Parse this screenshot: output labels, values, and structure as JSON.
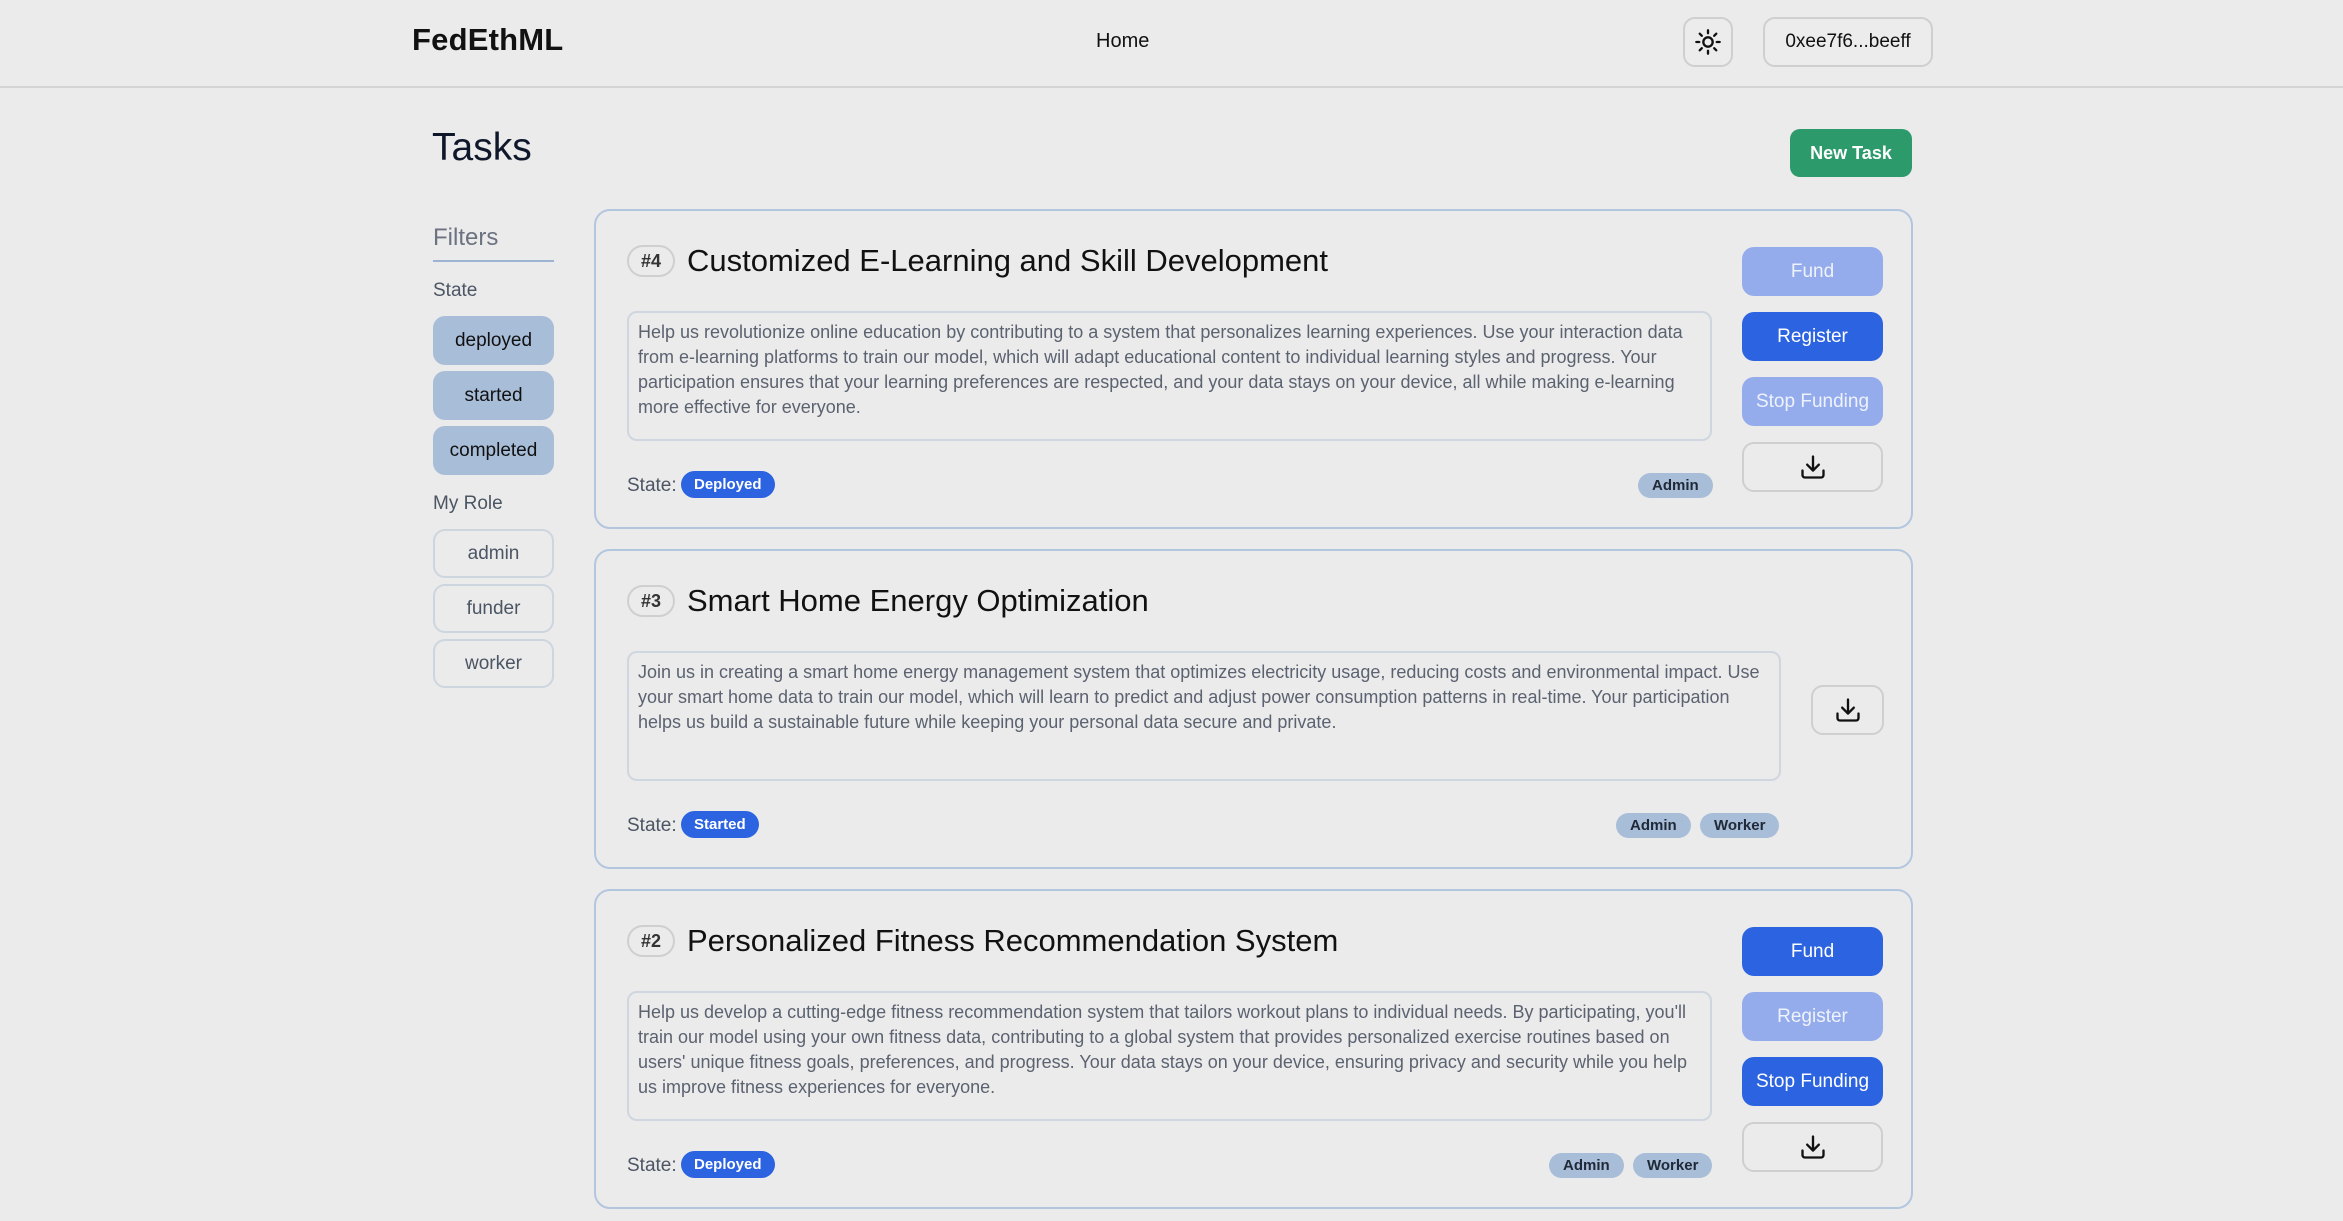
{
  "header": {
    "brand": "FedEthML",
    "nav": {
      "home": "Home"
    },
    "theme_icon": "sun-icon",
    "wallet": "0xee7f6...beeff"
  },
  "page": {
    "title": "Tasks",
    "new_task": "New Task"
  },
  "filters": {
    "title": "Filters",
    "state_label": "State",
    "states": [
      "deployed",
      "started",
      "completed"
    ],
    "role_label": "My Role",
    "roles": [
      "admin",
      "funder",
      "worker"
    ]
  },
  "tasks": [
    {
      "id": "#4",
      "title": "Customized E-Learning and Skill Development",
      "description": "Help us revolutionize online education by contributing to a system that personalizes learning experiences. Use your interaction data from e-learning platforms to train our model, which will adapt educational content to individual learning styles and progress. Your participation ensures that your learning preferences are respected, and your data stays on your device, all while making e-learning more effective for everyone.",
      "state_label": "State:",
      "state": "Deployed",
      "roles": [
        "Admin"
      ],
      "actions": {
        "fund": "Fund",
        "register": "Register",
        "stop_funding": "Stop Funding"
      },
      "action_states": {
        "fund": "disabled",
        "register": "enabled",
        "stop_funding": "disabled"
      },
      "download_icon": "download-icon"
    },
    {
      "id": "#3",
      "title": "Smart Home Energy Optimization",
      "description": "Join us in creating a smart home energy management system that optimizes electricity usage, reducing costs and environmental impact. Use your smart home data to train our model, which will learn to predict and adjust power consumption patterns in real-time. Your participation helps us build a sustainable future while keeping your personal data secure and private.",
      "state_label": "State:",
      "state": "Started",
      "roles": [
        "Admin",
        "Worker"
      ],
      "download_icon": "download-icon"
    },
    {
      "id": "#2",
      "title": "Personalized Fitness Recommendation System",
      "description": "Help us develop a cutting-edge fitness recommendation system that tailors workout plans to individual needs. By participating, you'll train our model using your own fitness data, contributing to a global system that provides personalized exercise routines based on users' unique fitness goals, preferences, and progress. Your data stays on your device, ensuring privacy and security while you help us improve fitness experiences for everyone.",
      "state_label": "State:",
      "state": "Deployed",
      "roles": [
        "Admin",
        "Worker"
      ],
      "actions": {
        "fund": "Fund",
        "register": "Register",
        "stop_funding": "Stop Funding"
      },
      "action_states": {
        "fund": "enabled",
        "register": "disabled",
        "stop_funding": "enabled"
      },
      "download_icon": "download-icon"
    }
  ],
  "colors": {
    "accent_blue": "#2b63e0",
    "accent_blue_disabled": "#94acec",
    "new_task_green": "#2d9a6b",
    "chip_filled": "#a8bdd8",
    "background": "#ebebeb"
  }
}
